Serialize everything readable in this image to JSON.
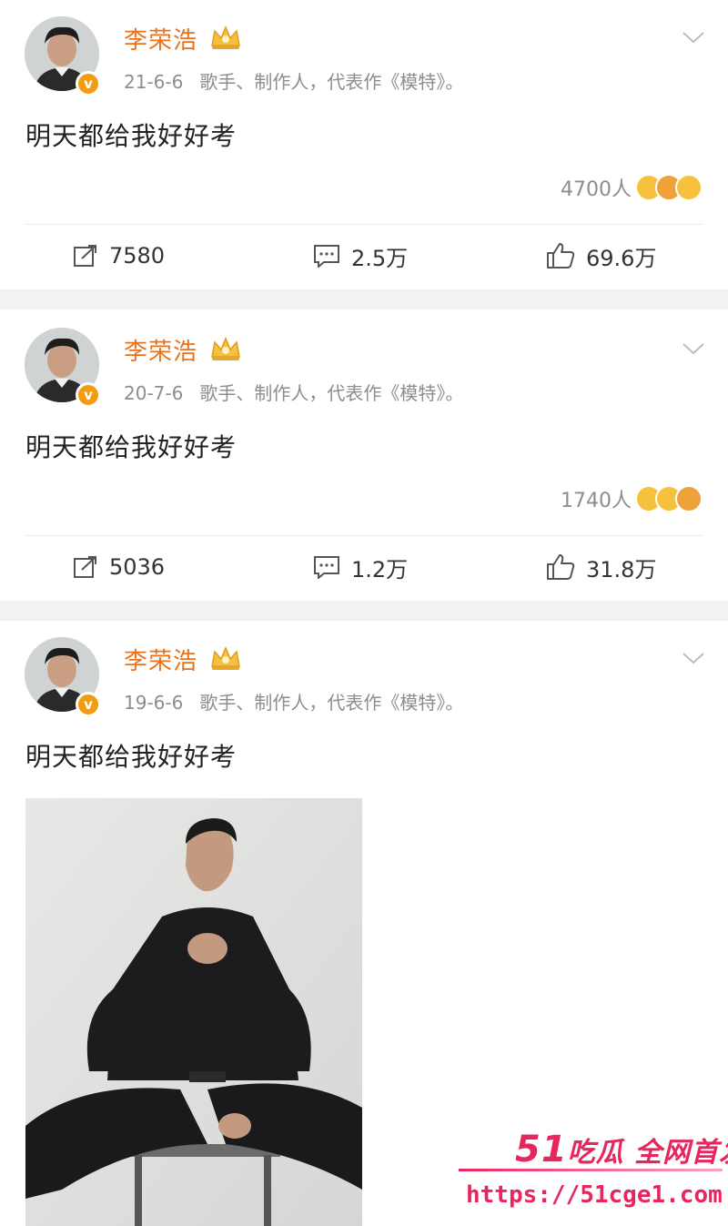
{
  "posts": [
    {
      "username": "李荣浩",
      "date": "21-6-6",
      "bio": "歌手、制作人，代表作《模特》。",
      "text": "明天都给我好好考",
      "reactions": "4700人",
      "repost": "7580",
      "comment": "2.5万",
      "like": "69.6万"
    },
    {
      "username": "李荣浩",
      "date": "20-7-6",
      "bio": "歌手、制作人，代表作《模特》。",
      "text": "明天都给我好好考",
      "reactions": "1740人",
      "repost": "5036",
      "comment": "1.2万",
      "like": "31.8万"
    },
    {
      "username": "李荣浩",
      "date": "19-6-6",
      "bio": "歌手、制作人，代表作《模特》。",
      "text": "明天都给我好好考"
    }
  ],
  "watermark": {
    "line1_num": "51",
    "line1_text": "吃瓜 全网首发",
    "url": "https://51cge1.com"
  },
  "colors": {
    "username": "#e8731c",
    "meta": "#8d8d8d",
    "separator": "#f2f2f2",
    "verified_badge": "#f39c12",
    "watermark": "#e8265e"
  },
  "icons": [
    "crown-badge-icon",
    "verified-v-icon",
    "chevron-down-icon",
    "repost-icon",
    "comment-icon",
    "like-thumb-icon",
    "reaction-emoji-icon"
  ]
}
